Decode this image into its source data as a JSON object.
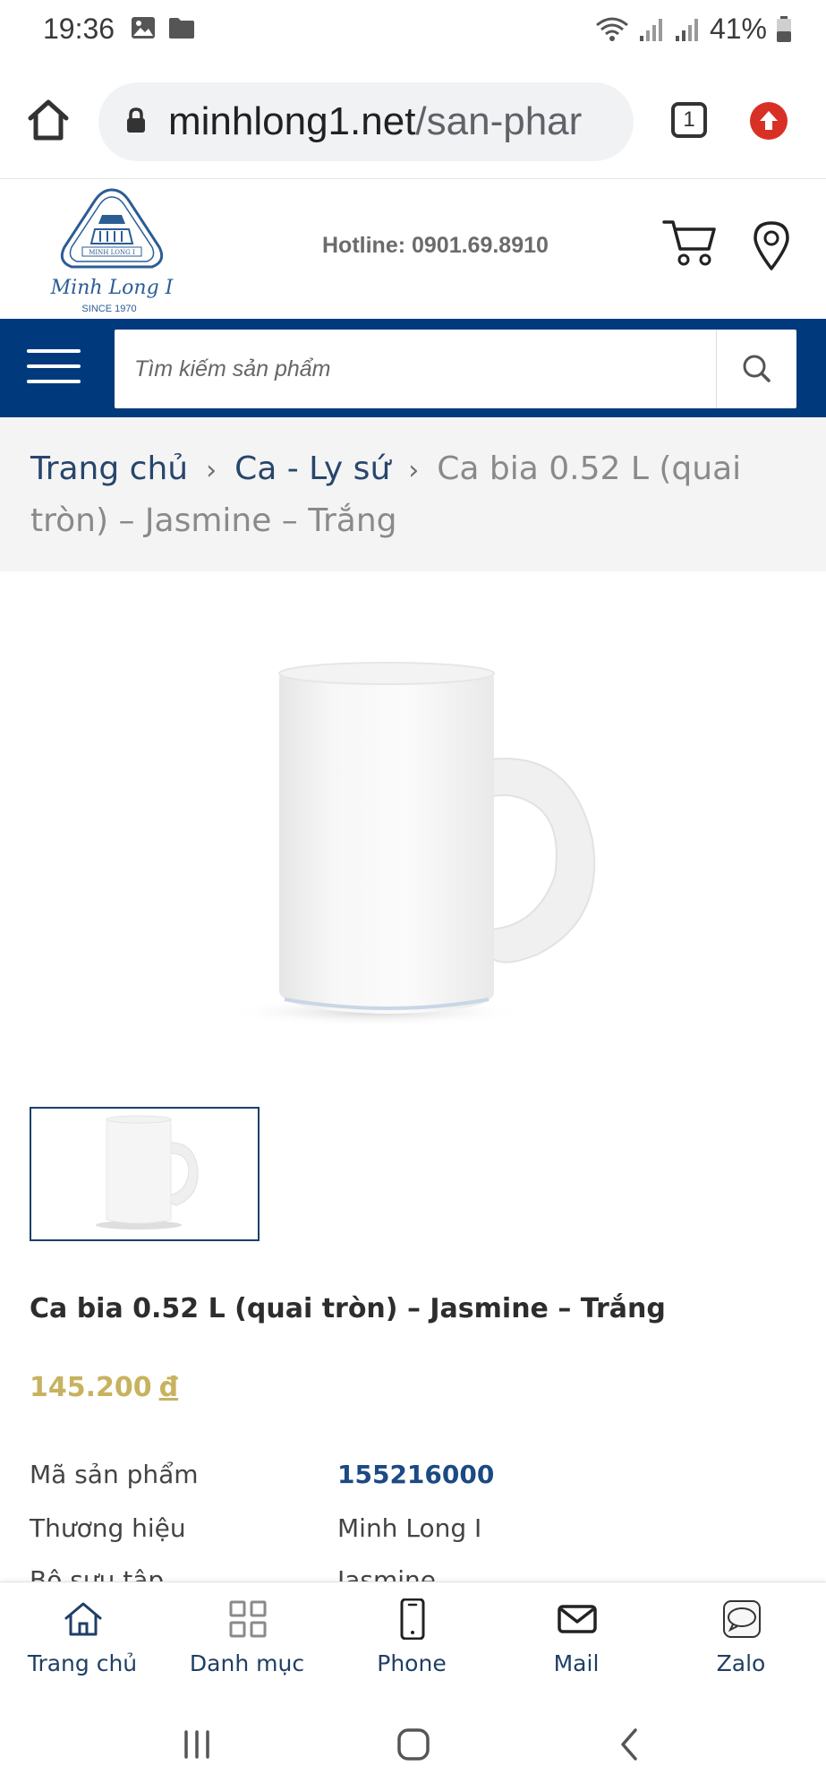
{
  "status_bar": {
    "time": "19:36",
    "battery": "41%",
    "icons": [
      "image-icon",
      "folder-icon",
      "wifi-icon",
      "signal-icon",
      "signal-icon",
      "battery-icon"
    ]
  },
  "browser": {
    "url_domain": "minhlong1.net",
    "url_path": "/san-phar",
    "tab_count": "1"
  },
  "header": {
    "logo_text": "MINH LONG I",
    "logo_script": "Minh Long I",
    "logo_since": "SINCE 1970",
    "hotline": "Hotline: 0901.69.8910"
  },
  "search": {
    "placeholder": "Tìm kiếm sản phẩm"
  },
  "breadcrumb": {
    "items": [
      "Trang chủ",
      "Ca - Ly sứ"
    ],
    "current": "Ca bia 0.52 L (quai tròn) – Jasmine – Trắng"
  },
  "product": {
    "title": "Ca bia 0.52 L (quai tròn) – Jasmine – Trắng",
    "price": "145.200",
    "currency": "đ",
    "specs": [
      {
        "label": "Mã sản phẩm",
        "value": "155216000"
      },
      {
        "label": "Thương hiệu",
        "value": "Minh Long I"
      },
      {
        "label": "Bộ sưu tập",
        "value": "Jasmine"
      }
    ]
  },
  "bottom_nav": {
    "items": [
      {
        "label": "Trang chủ",
        "icon": "home-icon"
      },
      {
        "label": "Danh mục",
        "icon": "grid-icon"
      },
      {
        "label": "Phone",
        "icon": "phone-icon"
      },
      {
        "label": "Mail",
        "icon": "mail-icon"
      },
      {
        "label": "Zalo",
        "icon": "zalo-icon"
      }
    ]
  },
  "colors": {
    "nav_blue": "#003a7d",
    "price_gold": "#c8b25e",
    "code_blue": "#1b4a84",
    "update_red": "#d93025"
  }
}
